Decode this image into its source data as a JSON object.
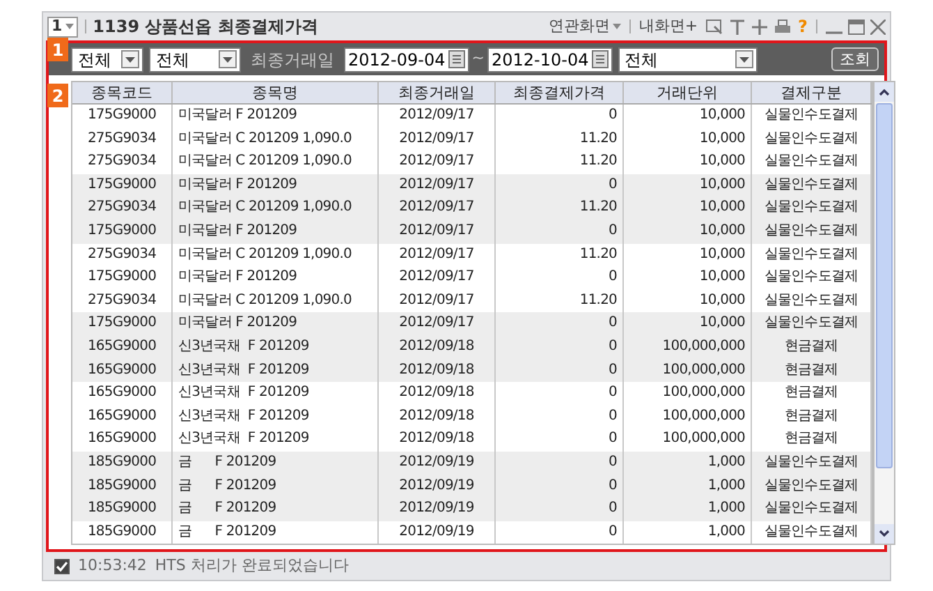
{
  "window": {
    "screen_number": "1",
    "title": "1139 상품선옵 최종결제가격",
    "related_menu": "연관화면",
    "my_screen": "내화면+",
    "help": "?"
  },
  "badges": [
    "1",
    "2"
  ],
  "toolbar": {
    "filter_1": "전체",
    "filter_2": "전체",
    "date_label": "최종거래일",
    "date_from": "2012-09-04",
    "range_separator": "~",
    "date_to": "2012-10-04",
    "filter_3": "전체",
    "search_button": "조회"
  },
  "table": {
    "columns": [
      "종목코드",
      "종목명",
      "최종거래일",
      "최종결제가격",
      "거래단위",
      "결제구분"
    ],
    "rows": [
      [
        "175G9000",
        "미국달러 F 201209",
        "2012/09/17",
        "0",
        "10,000",
        "실물인수도결제"
      ],
      [
        "275G9034",
        "미국달러 C 201209 1,090.0",
        "2012/09/17",
        "11.20",
        "10,000",
        "실물인수도결제"
      ],
      [
        "275G9034",
        "미국달러 C 201209 1,090.0",
        "2012/09/17",
        "11.20",
        "10,000",
        "실물인수도결제"
      ],
      [
        "175G9000",
        "미국달러 F 201209",
        "2012/09/17",
        "0",
        "10,000",
        "실물인수도결제"
      ],
      [
        "275G9034",
        "미국달러 C 201209 1,090.0",
        "2012/09/17",
        "11.20",
        "10,000",
        "실물인수도결제"
      ],
      [
        "175G9000",
        "미국달러 F 201209",
        "2012/09/17",
        "0",
        "10,000",
        "실물인수도결제"
      ],
      [
        "275G9034",
        "미국달러 C 201209 1,090.0",
        "2012/09/17",
        "11.20",
        "10,000",
        "실물인수도결제"
      ],
      [
        "175G9000",
        "미국달러 F 201209",
        "2012/09/17",
        "0",
        "10,000",
        "실물인수도결제"
      ],
      [
        "275G9034",
        "미국달러 C 201209 1,090.0",
        "2012/09/17",
        "11.20",
        "10,000",
        "실물인수도결제"
      ],
      [
        "175G9000",
        "미국달러 F 201209",
        "2012/09/17",
        "0",
        "10,000",
        "실물인수도결제"
      ],
      [
        "165G9000",
        "신3년국채  F 201209",
        "2012/09/18",
        "0",
        "100,000,000",
        "현금결제"
      ],
      [
        "165G9000",
        "신3년국채  F 201209",
        "2012/09/18",
        "0",
        "100,000,000",
        "현금결제"
      ],
      [
        "165G9000",
        "신3년국채  F 201209",
        "2012/09/18",
        "0",
        "100,000,000",
        "현금결제"
      ],
      [
        "165G9000",
        "신3년국채  F 201209",
        "2012/09/18",
        "0",
        "100,000,000",
        "현금결제"
      ],
      [
        "165G9000",
        "신3년국채  F 201209",
        "2012/09/18",
        "0",
        "100,000,000",
        "현금결제"
      ],
      [
        "185G9000",
        "금      F 201209",
        "2012/09/19",
        "0",
        "1,000",
        "실물인수도결제"
      ],
      [
        "185G9000",
        "금      F 201209",
        "2012/09/19",
        "0",
        "1,000",
        "실물인수도결제"
      ],
      [
        "185G9000",
        "금      F 201209",
        "2012/09/19",
        "0",
        "1,000",
        "실물인수도결제"
      ],
      [
        "185G9000",
        "금      F 201209",
        "2012/09/19",
        "0",
        "1,000",
        "실물인수도결제"
      ]
    ]
  },
  "status_bar": {
    "checked": true,
    "time": "10:53:42",
    "message": "HTS 처리가 완료되었습니다"
  }
}
